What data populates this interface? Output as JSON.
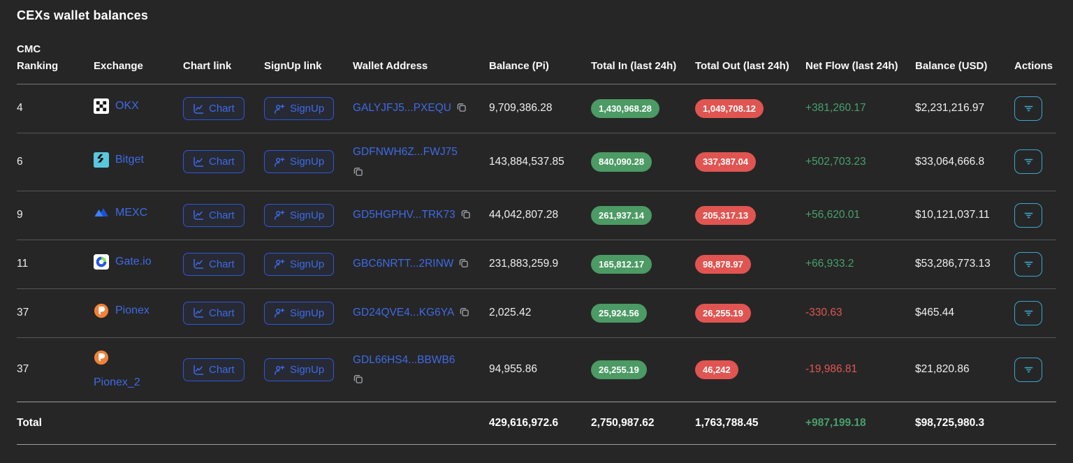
{
  "page": {
    "title": "CEXs wallet balances"
  },
  "colors": {
    "background": "#262626",
    "link_blue": "#3e6ae6",
    "badge_green": "#4c9a64",
    "badge_red": "#e05551",
    "netflow_green": "#48a06e",
    "netflow_red": "#e25653",
    "actions_cyan": "#3aa8d0"
  },
  "table": {
    "columns": [
      "CMC Ranking",
      "Exchange",
      "Chart link",
      "SignUp link",
      "Wallet Address",
      "Balance (Pi)",
      "Total In (last 24h)",
      "Total Out (last 24h)",
      "Net Flow (last 24h)",
      "Balance (USD)",
      "Actions"
    ],
    "buttons": {
      "chart": "Chart",
      "signup": "SignUp"
    },
    "icons": {
      "chart": "line-chart-icon",
      "signup": "person-add-icon",
      "copy": "copy-icon",
      "actions": "filter-lines-icon"
    },
    "rows": [
      {
        "rank": "4",
        "name": "OKX",
        "logo": "okx",
        "wallet": "GALYJFJ5...PXEQU",
        "wallet_wrap": false,
        "name_wrap": false,
        "balance_pi": "9,709,386.28",
        "total_in": "1,430,968.28",
        "total_out": "1,049,708.12",
        "net_flow": "+381,260.17",
        "net_flow_positive": true,
        "balance_usd": "$2,231,216.97"
      },
      {
        "rank": "6",
        "name": "Bitget",
        "logo": "bitget",
        "wallet": "GDFNWH6Z...FWJ75",
        "wallet_wrap": true,
        "name_wrap": false,
        "balance_pi": "143,884,537.85",
        "total_in": "840,090.28",
        "total_out": "337,387.04",
        "net_flow": "+502,703.23",
        "net_flow_positive": true,
        "balance_usd": "$33,064,666.8"
      },
      {
        "rank": "9",
        "name": "MEXC",
        "logo": "mexc",
        "wallet": "GD5HGPHV...TRK73",
        "wallet_wrap": false,
        "name_wrap": false,
        "balance_pi": "44,042,807.28",
        "total_in": "261,937.14",
        "total_out": "205,317.13",
        "net_flow": "+56,620.01",
        "net_flow_positive": true,
        "balance_usd": "$10,121,037.11"
      },
      {
        "rank": "11",
        "name": "Gate.io",
        "logo": "gateio",
        "wallet": "GBC6NRTT...2RINW",
        "wallet_wrap": false,
        "name_wrap": false,
        "balance_pi": "231,883,259.9",
        "total_in": "165,812.17",
        "total_out": "98,878.97",
        "net_flow": "+66,933.2",
        "net_flow_positive": true,
        "balance_usd": "$53,286,773.13"
      },
      {
        "rank": "37",
        "name": "Pionex",
        "logo": "pionex",
        "wallet": "GD24QVE4...KG6YA",
        "wallet_wrap": false,
        "name_wrap": false,
        "balance_pi": "2,025.42",
        "total_in": "25,924.56",
        "total_out": "26,255.19",
        "net_flow": "-330.63",
        "net_flow_positive": false,
        "balance_usd": "$465.44"
      },
      {
        "rank": "37",
        "name": "Pionex_2",
        "logo": "pionex",
        "wallet": "GDL66HS4...BBWB6",
        "wallet_wrap": true,
        "name_wrap": true,
        "balance_pi": "94,955.86",
        "total_in": "26,255.19",
        "total_out": "46,242",
        "net_flow": "-19,986.81",
        "net_flow_positive": false,
        "balance_usd": "$21,820.86"
      }
    ],
    "total": {
      "label": "Total",
      "balance_pi": "429,616,972.6",
      "total_in": "2,750,987.62",
      "total_out": "1,763,788.45",
      "net_flow": "+987,199.18",
      "net_flow_positive": true,
      "balance_usd": "$98,725,980.3"
    }
  }
}
